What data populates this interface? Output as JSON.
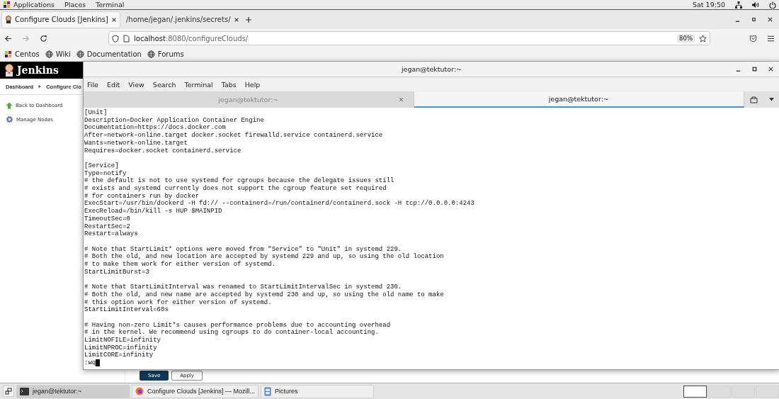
{
  "top_bar": {
    "menus": [
      "Applications",
      "Places",
      "Terminal"
    ],
    "clock": "Sat 19:50"
  },
  "browser": {
    "tabs": [
      {
        "title": "Configure Clouds [Jenkins]",
        "selected": true
      },
      {
        "title": "/home/jegan/.jenkins/secrets/",
        "selected": false
      }
    ],
    "url": {
      "host": "localhost",
      "path": ":8080/configureClouds/"
    },
    "zoom": "80%",
    "bookmarks": [
      {
        "label": "Centos",
        "kind": "centos"
      },
      {
        "label": "Wiki",
        "kind": "globe"
      },
      {
        "label": "Documentation",
        "kind": "globe"
      },
      {
        "label": "Forums",
        "kind": "globe"
      }
    ]
  },
  "jenkins": {
    "logo": "Jenkins",
    "breadcrumbs": [
      "Dashboard",
      "Configure Clo"
    ],
    "sidebar": [
      {
        "label": "Back to Dashboard",
        "kind": "up"
      },
      {
        "label": "Manage Nodes",
        "kind": "gear"
      }
    ],
    "buttons": [
      {
        "label": "Save",
        "kind": "primary"
      },
      {
        "label": "Apply",
        "kind": "secondary"
      }
    ]
  },
  "terminal": {
    "title": "jegan@tektutor:~",
    "menu": [
      "File",
      "Edit",
      "View",
      "Search",
      "Terminal",
      "Tabs",
      "Help"
    ],
    "tabs": [
      {
        "title": "jegan@tektutor:~",
        "selected": false
      },
      {
        "title": "jegan@tektutor:~",
        "selected": true
      }
    ],
    "blocks": [
      [
        "[Unit]",
        "Description=Docker Application Container Engine",
        "Documentation=https://docs.docker.com",
        "After=network-online.target docker.socket firewalld.service containerd.service",
        "Wants=network-online.target",
        "Requires=docker.socket containerd.service"
      ],
      [
        "[Service]",
        "Type=notify",
        "# the default is not to use systemd for cgroups because the delegate issues still",
        "# exists and systemd currently does not support the cgroup feature set required",
        "# for containers run by docker",
        "ExecStart=/usr/bin/dockerd -H fd:// --containerd=/run/containerd/containerd.sock -H tcp://0.0.0.0:4243",
        "ExecReload=/bin/kill -s HUP $MAINPID",
        "TimeoutSec=0",
        "RestartSec=2",
        "Restart=always"
      ],
      [
        "# Note that StartLimit* options were moved from \"Service\" to \"Unit\" in systemd 229.",
        "# Both the old, and new location are accepted by systemd 229 and up, so using the old location",
        "# to make them work for either version of systemd.",
        "StartLimitBurst=3"
      ],
      [
        "# Note that StartLimitInterval was renamed to StartLimitIntervalSec in systemd 230.",
        "# Both the old, and new name are accepted by systemd 230 and up, so using the old name to make",
        "# this option work for either version of systemd.",
        "StartLimitInterval=60s"
      ],
      [
        "# Having non-zero Limit*s causes performance problems due to accounting overhead",
        "# in the kernel. We recommend using cgroups to do container-local accounting.",
        "LimitNOFILE=infinity",
        "LimitNPROC=infinity",
        "LimitCORE=infinity"
      ]
    ],
    "command": ":wq"
  },
  "taskbar": {
    "items": [
      {
        "label": "jegan@tektutor:~",
        "kind": "terminal",
        "selected": true
      },
      {
        "label": "Configure Clouds [Jenkins] — Mozill...",
        "kind": "firefox",
        "selected": false
      },
      {
        "label": "Pictures",
        "kind": "files",
        "selected": false
      }
    ],
    "workspaces": [
      {
        "selected": true
      },
      {
        "selected": false
      },
      {
        "selected": false
      },
      {
        "selected": false
      }
    ]
  }
}
